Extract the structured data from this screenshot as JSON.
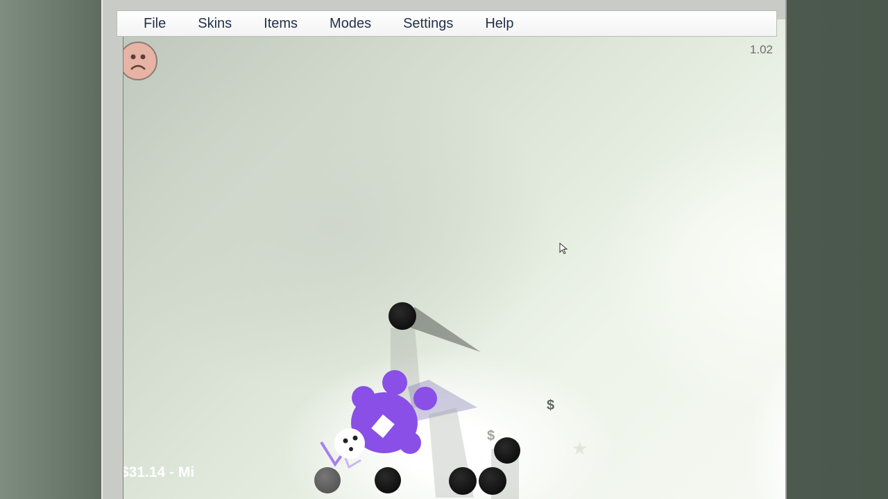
{
  "menu": {
    "items": [
      {
        "label": "File"
      },
      {
        "label": "Skins"
      },
      {
        "label": "Items"
      },
      {
        "label": "Modes"
      },
      {
        "label": "Settings"
      },
      {
        "label": "Help"
      }
    ]
  },
  "game": {
    "version": "1.02",
    "money_status": "$31.14  -  Mi",
    "dollar_symbol": "$",
    "mood": "sad-face-icon",
    "player_color": "#8b4fe0",
    "background_color": "#e5ece0"
  }
}
